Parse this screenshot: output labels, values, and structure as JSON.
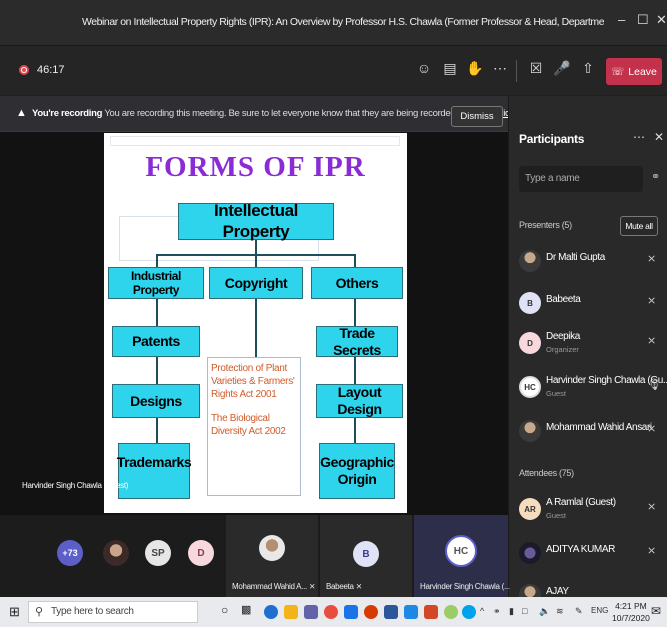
{
  "window": {
    "title": "Webinar on Intellectual Property Rights (IPR): An Overview by Professor H.S. Chawla (Former Professor & Head, Department of Genetics and Plant Breeding, G...",
    "minimize": "–",
    "maximize": "☐",
    "close": "✕"
  },
  "toolbar": {
    "timer": "46:17",
    "leave_label": "Leave"
  },
  "banner": {
    "bold": "You're recording",
    "text": "You are recording this meeting. Be sure to let everyone know that they are being recorded.",
    "link": "Privacy policy",
    "dismiss": "Dismiss"
  },
  "slide": {
    "title": "FORMS OF IPR",
    "root": "Intellectual Property",
    "col1": "Industrial Property",
    "col2": "Copyright",
    "col3": "Others",
    "patents": "Patents",
    "designs": "Designs",
    "trademarks": "Trademarks",
    "trade_secrets": "Trade Secrets",
    "layout_design": "Layout Design",
    "geographic_origin": "Geographic Origin",
    "protection_1": "Protection of Plant Varieties & Farmers' Rights Act 2001",
    "protection_2": "The Biological Diversity Act 2002"
  },
  "stage": {
    "speaker_label": "Harvinder Singh Chawla (Guest)"
  },
  "participants": {
    "title": "Participants",
    "search_placeholder": "Type a name",
    "presenters_label": "Presenters (5)",
    "mute_all": "Mute all",
    "attendees_label": "Attendees (75)",
    "presenters": [
      {
        "name": "Dr Malti Gupta",
        "role": "",
        "initials": ""
      },
      {
        "name": "Babeeta",
        "role": "",
        "initials": "B"
      },
      {
        "name": "Deepika",
        "role": "Organizer",
        "initials": "D"
      },
      {
        "name": "Harvinder Singh Chawla (Gu...",
        "role": "Guest",
        "initials": "HC"
      },
      {
        "name": "Mohammad Wahid Ansari",
        "role": "",
        "initials": ""
      }
    ],
    "attendees": [
      {
        "name": "A Ramlal (Guest)",
        "role": "Guest",
        "initials": "AR"
      },
      {
        "name": "ADITYA KUMAR",
        "role": "",
        "initials": ""
      },
      {
        "name": "AJAY",
        "role": "",
        "initials": ""
      }
    ]
  },
  "strip": {
    "overflow": "+73",
    "sp": "SP",
    "d": "D",
    "b": "B",
    "hc": "HC",
    "tile1": "Mohammad Wahid A...",
    "tile2": "Babeeta",
    "tile3": "Harvinder Singh Chawla (..."
  },
  "taskbar": {
    "search_placeholder": "Type here to search",
    "lang": "ENG",
    "time": "4:21 PM",
    "date": "10/7/2020"
  },
  "colors": {
    "leave": "#c4314b",
    "slide_title": "#8b2bd6",
    "box_fill": "#2ed3ec",
    "protection_text": "#cf5b2a",
    "avatar_b": "#dfe3f5",
    "avatar_d": "#f6d8dd",
    "avatar_ar": "#f6dcbf"
  }
}
